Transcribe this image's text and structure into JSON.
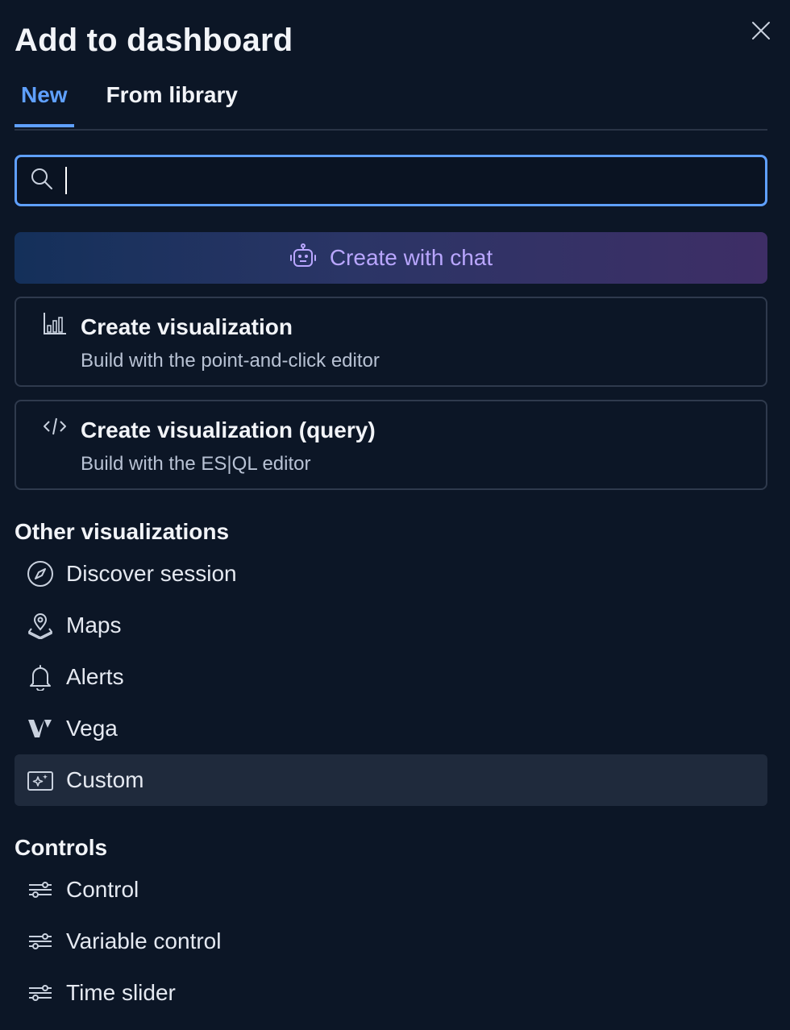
{
  "dialog": {
    "title": "Add to dashboard",
    "close_icon": "close-icon"
  },
  "tabs": [
    {
      "label": "New",
      "active": true
    },
    {
      "label": "From library",
      "active": false
    }
  ],
  "search": {
    "value": "",
    "placeholder": "",
    "icon": "search-icon"
  },
  "chat_button": {
    "label": "Create with chat",
    "icon": "robot-icon"
  },
  "cards": [
    {
      "title": "Create visualization",
      "description": "Build with the point-and-click editor",
      "icon": "bar-chart-icon"
    },
    {
      "title": "Create visualization (query)",
      "description": "Build with the ES|QL editor",
      "icon": "code-icon"
    }
  ],
  "other_visualizations": {
    "title": "Other visualizations",
    "items": [
      {
        "label": "Discover session",
        "icon": "compass-icon"
      },
      {
        "label": "Maps",
        "icon": "map-pin-icon"
      },
      {
        "label": "Alerts",
        "icon": "bell-icon"
      },
      {
        "label": "Vega",
        "icon": "vega-icon"
      },
      {
        "label": "Custom",
        "icon": "sparkle-icon",
        "highlighted": true
      }
    ]
  },
  "controls": {
    "title": "Controls",
    "items": [
      {
        "label": "Control",
        "icon": "sliders-icon"
      },
      {
        "label": "Variable control",
        "icon": "sliders-icon"
      },
      {
        "label": "Time slider",
        "icon": "sliders-icon"
      }
    ]
  },
  "colors": {
    "background": "#0c1626",
    "accent": "#5fa0ff",
    "chat_text": "#b9a6ff",
    "border": "#2f3a4d",
    "highlight_row": "#1f2a3c"
  }
}
